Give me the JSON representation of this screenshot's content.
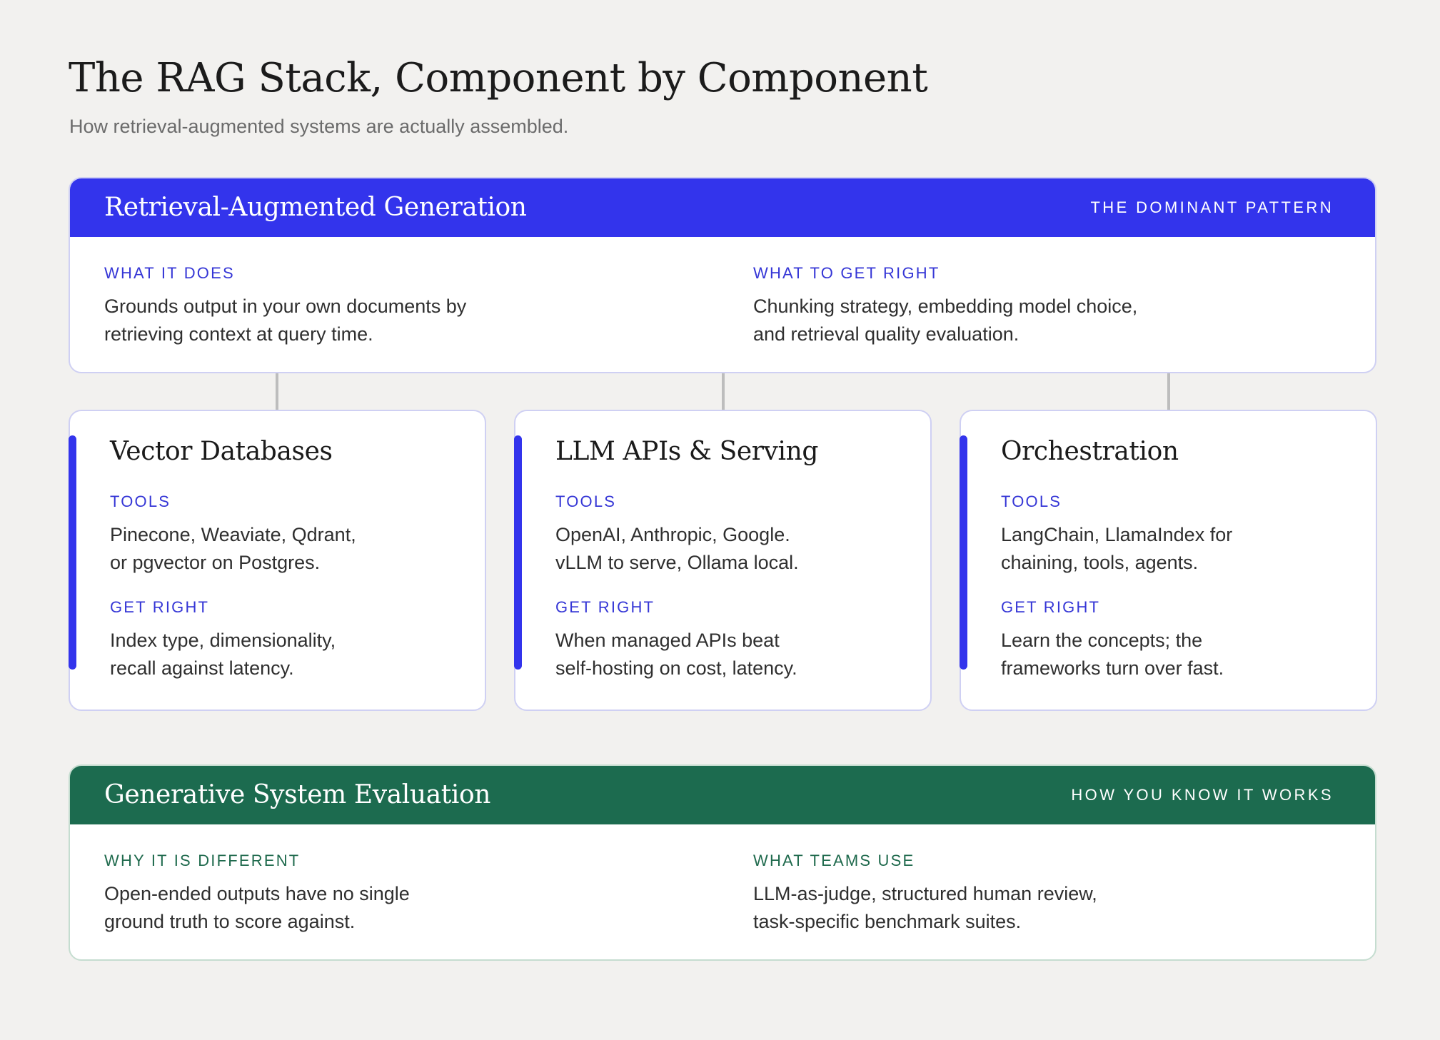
{
  "page": {
    "title": "The RAG Stack, Component by Component",
    "subtitle": "How retrieval-augmented systems are actually assembled."
  },
  "rag_panel": {
    "title": "Retrieval-Augmented Generation",
    "tag": "THE DOMINANT PATTERN",
    "color": "#3334ec",
    "left": {
      "label": "WHAT IT DOES",
      "text": "Grounds output in your own documents by\nretrieving context at query time."
    },
    "right": {
      "label": "WHAT TO GET RIGHT",
      "text": "Chunking strategy, embedding model choice,\nand retrieval quality evaluation."
    }
  },
  "components": [
    {
      "title": "Vector Databases",
      "tools_label": "TOOLS",
      "tools": "Pinecone, Weaviate, Qdrant,\nor pgvector on Postgres.",
      "right_label": "GET RIGHT",
      "right": "Index type, dimensionality,\nrecall against latency."
    },
    {
      "title": "LLM APIs & Serving",
      "tools_label": "TOOLS",
      "tools": "OpenAI, Anthropic, Google.\nvLLM to serve, Ollama local.",
      "right_label": "GET RIGHT",
      "right": "When managed APIs beat\nself-hosting on cost, latency."
    },
    {
      "title": "Orchestration",
      "tools_label": "TOOLS",
      "tools": "LangChain, LlamaIndex for\nchaining, tools, agents.",
      "right_label": "GET RIGHT",
      "right": "Learn the concepts; the\nframeworks turn over fast."
    }
  ],
  "eval_panel": {
    "title": "Generative System Evaluation",
    "tag": "HOW YOU KNOW IT WORKS",
    "color": "#1c6b4f",
    "left": {
      "label": "WHY IT IS DIFFERENT",
      "text": "Open-ended outputs have no single\nground truth to score against."
    },
    "right": {
      "label": "WHAT TEAMS USE",
      "text": "LLM-as-judge, structured human review,\ntask-specific benchmark suites."
    }
  }
}
